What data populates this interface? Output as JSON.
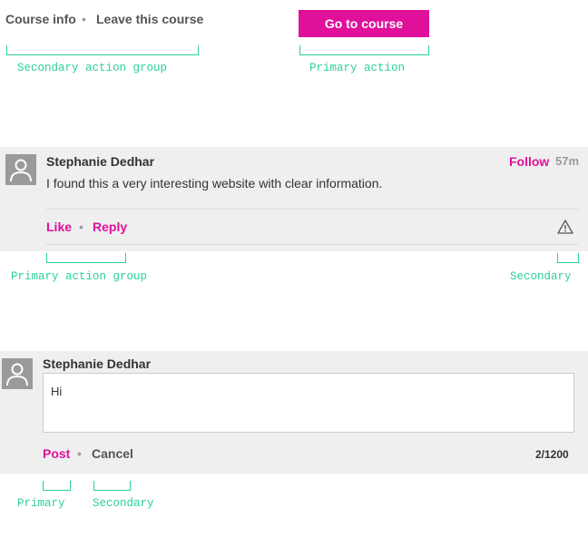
{
  "section1": {
    "course_info": "Course info",
    "separator": "•",
    "leave_course": "Leave this course",
    "go_to_course": "Go to course",
    "anno_secondary_group": "Secondary action group",
    "anno_primary": "Primary action"
  },
  "section2": {
    "author": "Stephanie Dedhar",
    "follow": "Follow",
    "time": "57m",
    "comment": "I found this a very interesting website with clear information.",
    "like": "Like",
    "separator": "•",
    "reply": "Reply",
    "anno_primary_group": "Primary action group",
    "anno_secondary": "Secondary"
  },
  "section3": {
    "author": "Stephanie Dedhar",
    "input_value": "Hi",
    "post": "Post",
    "separator": "•",
    "cancel": "Cancel",
    "counter": "2/1200",
    "anno_primary": "Primary",
    "anno_secondary": "Secondary"
  },
  "colors": {
    "accent": "#e0109a",
    "annotation": "#2bd19a",
    "panel_bg": "#efefef"
  },
  "icons": {
    "avatar": "user-avatar-icon",
    "report": "warning-triangle-icon"
  }
}
